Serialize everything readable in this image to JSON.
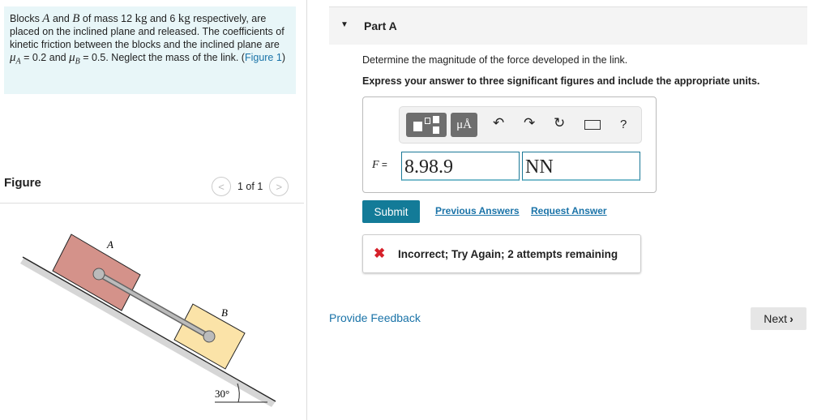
{
  "problem": {
    "t1": "Blocks ",
    "A": "A",
    "t2": " and ",
    "B": "B",
    "t3": " of mass 12 ",
    "kg1": "kg",
    "t4": " and 6 ",
    "kg2": "kg",
    "t5": " respectively, are placed on the inclined plane and released. The coefficients of kinetic friction between the blocks and the inclined plane are ",
    "muA": "μ",
    "subA": "A",
    "t6": " = 0.2 and ",
    "muB": "μ",
    "subB": "B",
    "t7": " = 0.5. Neglect the mass of the link. (",
    "figlink": "Figure 1",
    "t8": ")"
  },
  "figure": {
    "label": "Figure",
    "pager": "1 of 1",
    "prev": "<",
    "next": ">",
    "block_a": "A",
    "block_b": "B",
    "angle": "30°",
    "colors": {
      "block_a": "#d4928a",
      "block_b": "#fbe3a8"
    }
  },
  "part": {
    "title": "Part A",
    "question": "Determine the magnitude of the force developed in the link.",
    "instruction": "Express your answer to three significant figures and include the appropriate units."
  },
  "toolbar": {
    "units_button": "μÅ",
    "help": "?",
    "icons": [
      "templates-icon",
      "units-icon",
      "undo-icon",
      "redo-icon",
      "reset-icon",
      "keyboard-icon",
      "help-icon"
    ]
  },
  "answer": {
    "label": "F",
    "eq": " =",
    "value": "8.98.9",
    "units": "NN"
  },
  "actions": {
    "submit": "Submit",
    "previous": "Previous Answers",
    "request": "Request Answer"
  },
  "feedback": {
    "icon": "✖",
    "message": "Incorrect; Try Again; 2 attempts remaining"
  },
  "footer": {
    "provide": "Provide Feedback",
    "next": "Next"
  }
}
